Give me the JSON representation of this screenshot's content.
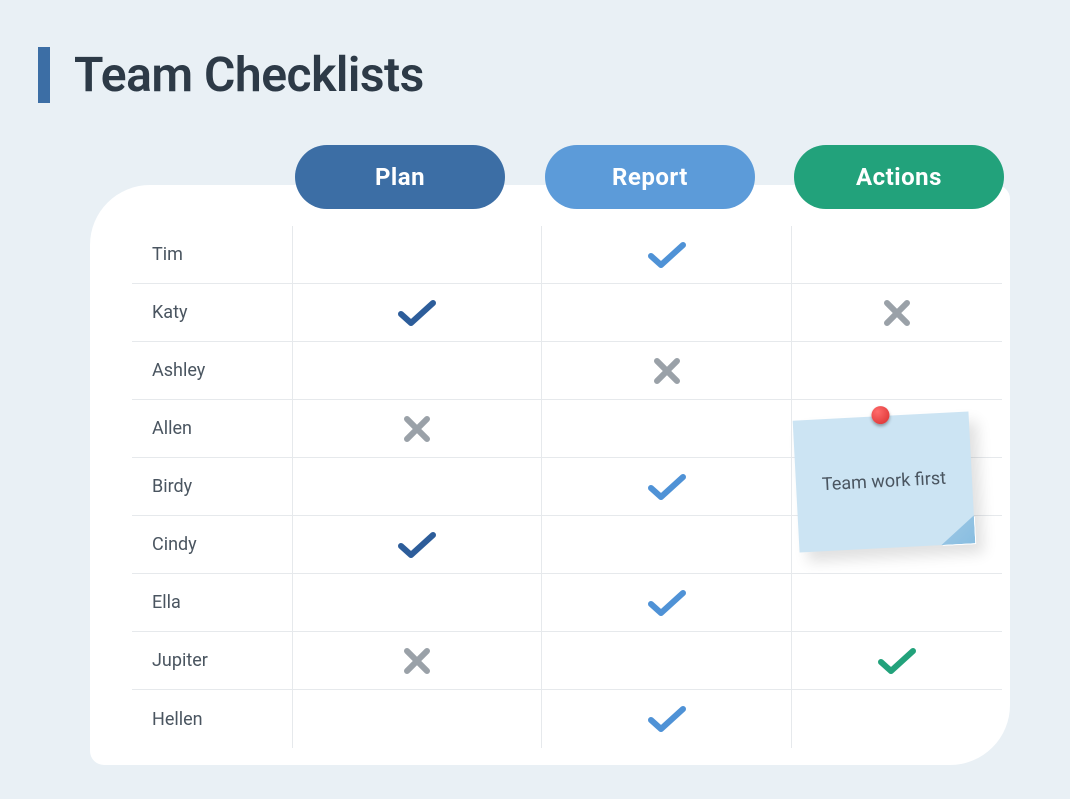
{
  "title": "Team Checklists",
  "columns": {
    "plan": "Plan",
    "report": "Report",
    "actions": "Actions"
  },
  "sticky_note": "Team work first",
  "colors": {
    "plan_pill": "#3c6ea5",
    "report_pill": "#5c9bd9",
    "actions_pill": "#22a27b",
    "check_dark": "#2d5d9a",
    "check_light": "#4f92d6",
    "check_green": "#22a27b",
    "cross_gray": "#9aa1a8"
  },
  "rows": [
    {
      "name": "Tim",
      "plan": "",
      "report": "check-light",
      "actions": ""
    },
    {
      "name": "Katy",
      "plan": "check-dark",
      "report": "",
      "actions": "cross-gray"
    },
    {
      "name": "Ashley",
      "plan": "",
      "report": "cross-gray",
      "actions": ""
    },
    {
      "name": "Allen",
      "plan": "cross-gray",
      "report": "",
      "actions": ""
    },
    {
      "name": "Birdy",
      "plan": "",
      "report": "check-light",
      "actions": ""
    },
    {
      "name": "Cindy",
      "plan": "check-dark",
      "report": "",
      "actions": ""
    },
    {
      "name": "Ella",
      "plan": "",
      "report": "check-light",
      "actions": ""
    },
    {
      "name": "Jupiter",
      "plan": "cross-gray",
      "report": "",
      "actions": "check-green"
    },
    {
      "name": "Hellen",
      "plan": "",
      "report": "check-light",
      "actions": ""
    }
  ]
}
